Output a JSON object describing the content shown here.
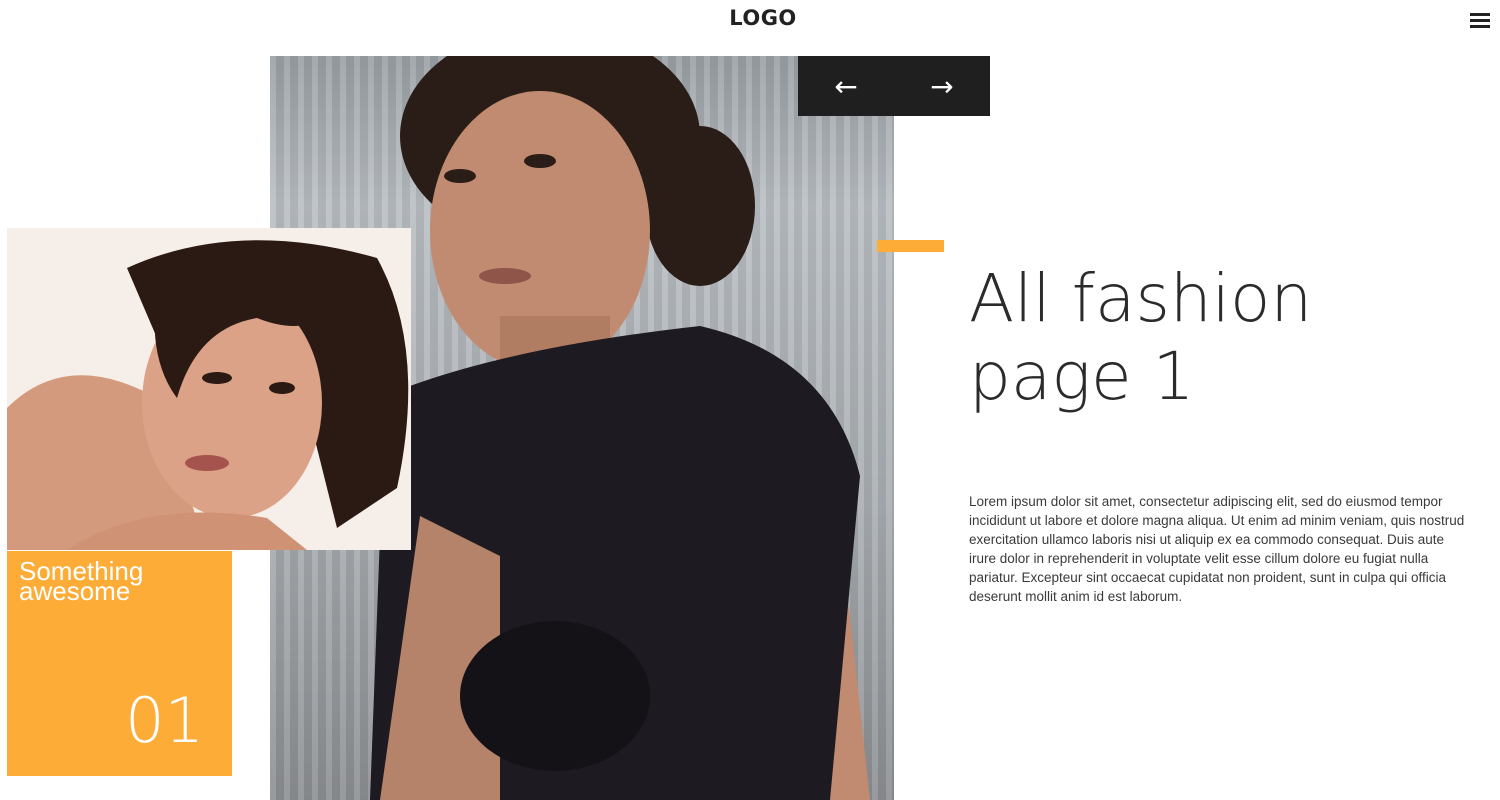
{
  "header": {
    "logo": "LOGO",
    "menu_icon": "hamburger-menu-icon"
  },
  "slider": {
    "prev_icon": "←",
    "next_icon": "→"
  },
  "hero": {
    "title": "All fashion page 1",
    "body": "Lorem ipsum dolor sit amet, consectetur adipiscing elit, sed do eiusmod tempor incididunt ut labore et dolore magna aliqua. Ut enim ad minim veniam, quis nostrud exercitation ullamco laboris nisi ut aliquip ex ea commodo consequat. Duis aute irure dolor in reprehenderit in voluptate velit esse cillum dolore eu fugiat nulla pariatur. Excepteur sint occaecat cupidatat non proident, sunt in culpa qui officia deserunt mollit anim id est laborum."
  },
  "card": {
    "label": "Something awesome",
    "number": "01"
  },
  "colors": {
    "accent": "#fdac38",
    "nav_bg": "#1f1f1f",
    "text": "#2b2b2b"
  }
}
